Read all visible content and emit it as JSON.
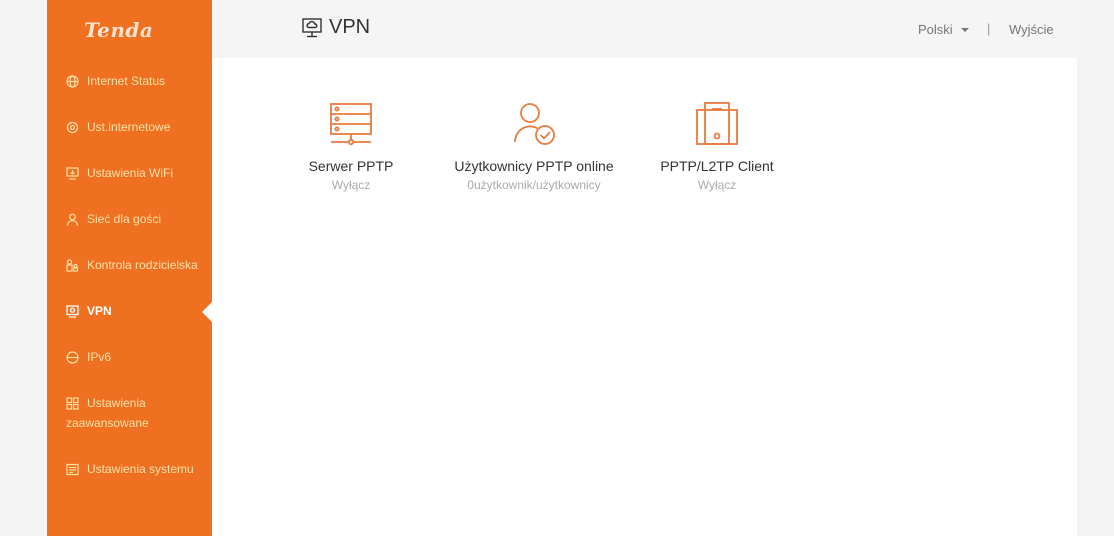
{
  "brand": {
    "logo": "Tenda",
    "accent": "#f07021"
  },
  "sidebar": {
    "items": [
      {
        "label": "Internet Status",
        "icon": "globe-icon"
      },
      {
        "label": "Ust.internetowe",
        "icon": "settings-icon"
      },
      {
        "label": "Ustawienia WiFi",
        "icon": "wifi-screen-icon"
      },
      {
        "label": "Sieć dla gości",
        "icon": "guest-user-icon"
      },
      {
        "label": "Kontrola rodzicielska",
        "icon": "family-icon"
      },
      {
        "label": "VPN",
        "icon": "vpn-icon",
        "active": true
      },
      {
        "label": "IPv6",
        "icon": "ipv6-icon"
      },
      {
        "label": "Ustawienia",
        "label2": "zaawansowane",
        "icon": "grid-icon"
      },
      {
        "label": "Ustawienia systemu",
        "icon": "system-icon"
      }
    ]
  },
  "header": {
    "title": "VPN",
    "language": "Polski",
    "separator": "|",
    "logout": "Wyjście"
  },
  "cards": [
    {
      "title": "Serwer PPTP",
      "status": "Wyłącz",
      "icon": "server-icon"
    },
    {
      "title": "Użytkownicy PPTP online",
      "status": "0użytkownik/użytkownicy",
      "icon": "user-check-icon"
    },
    {
      "title": "PPTP/L2TP Client",
      "status": "Wyłącz",
      "icon": "device-client-icon"
    }
  ]
}
